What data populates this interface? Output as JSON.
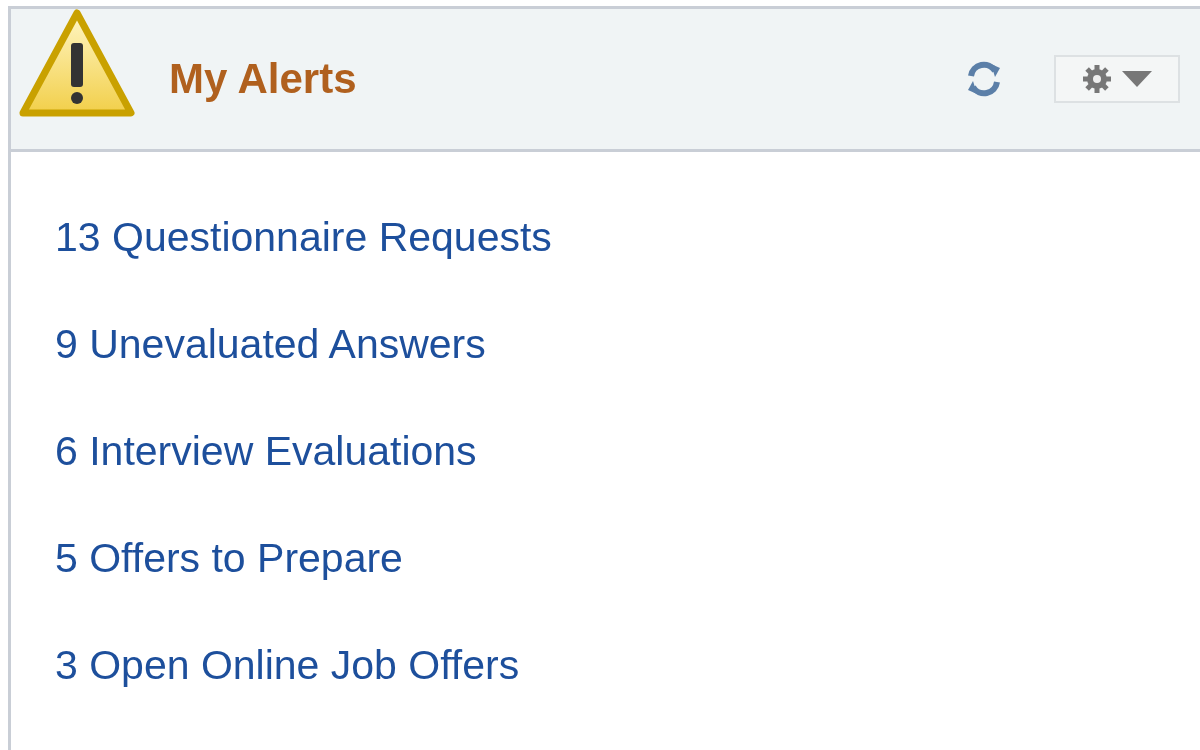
{
  "header": {
    "title": "My Alerts"
  },
  "alerts": [
    {
      "label": "13 Questionnaire Requests"
    },
    {
      "label": "9 Unevaluated Answers"
    },
    {
      "label": "6 Interview Evaluations"
    },
    {
      "label": "5 Offers to Prepare"
    },
    {
      "label": "3 Open Online Job Offers"
    }
  ]
}
